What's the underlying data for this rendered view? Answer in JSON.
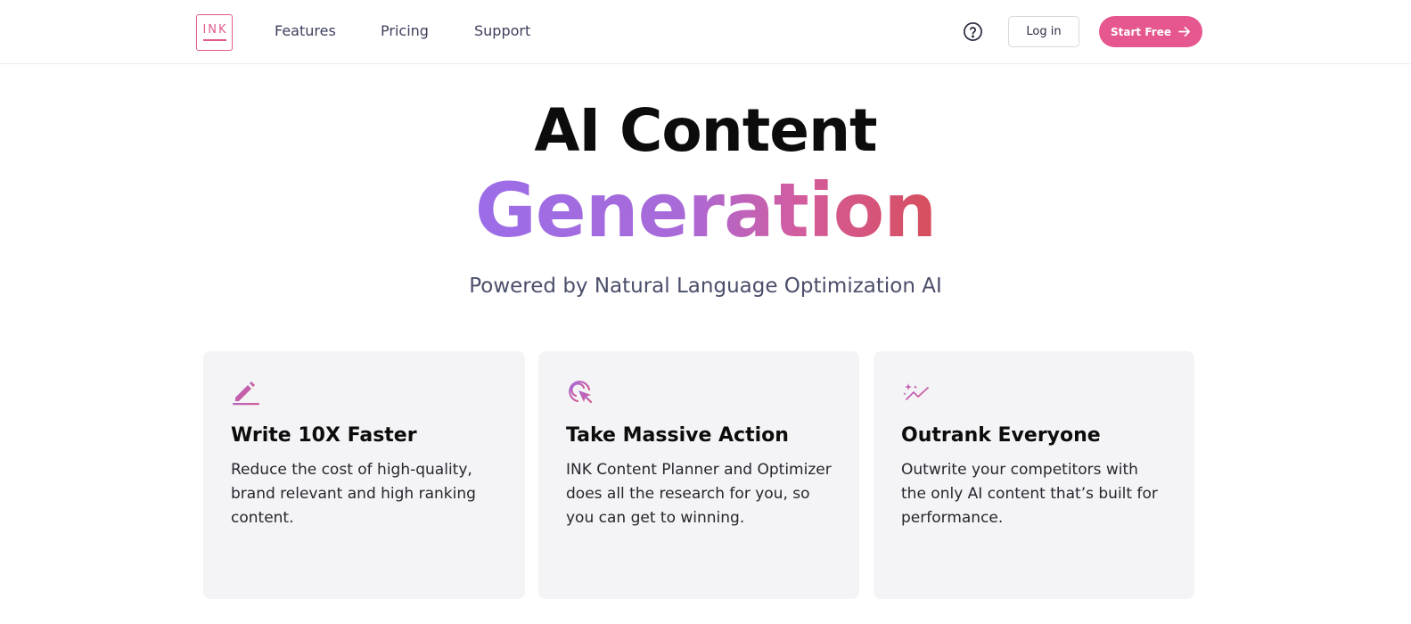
{
  "header": {
    "logo_text": "INK",
    "nav": [
      {
        "label": "Features"
      },
      {
        "label": "Pricing"
      },
      {
        "label": "Support"
      }
    ],
    "help_icon": "question-circle-icon",
    "login_label": "Log in",
    "start_label": "Start Free",
    "start_icon": "arrow-right-icon"
  },
  "hero": {
    "title_line1": "AI Content",
    "title_line2": "Generation",
    "subtitle": "Powered by Natural Language Optimization AI"
  },
  "features": [
    {
      "icon": "pencil-icon",
      "title": "Write 10X Faster",
      "text": "Reduce the cost of high-quality, brand relevant and high ranking content."
    },
    {
      "icon": "cursor-click-icon",
      "title": "Take Massive Action",
      "text": "INK Content Planner and Optimizer does all the research for you, so you can get to winning."
    },
    {
      "icon": "sparkle-trend-icon",
      "title": "Outrank Everyone",
      "text": "Outwrite your competitors with the only AI content that’s built for performance."
    }
  ],
  "colors": {
    "brand_pink": "#e5578e",
    "gradient_start": "#9b6de8",
    "gradient_end": "#d64e5b",
    "card_bg": "#f4f4f6"
  }
}
